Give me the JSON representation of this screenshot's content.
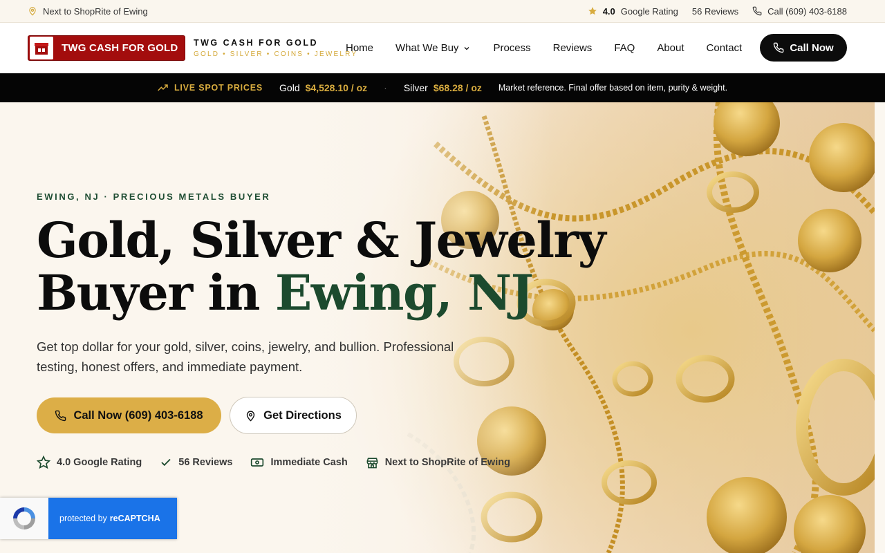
{
  "topbar": {
    "location": "Next to ShopRite of Ewing",
    "rating_value": "4.0",
    "rating_label": "Google Rating",
    "reviews": "56 Reviews",
    "phone": "Call (609) 403-6188"
  },
  "header": {
    "logo_badge": "TWG CASH FOR GOLD",
    "logo_title": "TWG CASH FOR GOLD",
    "logo_subtitle": "GOLD • SILVER • COINS • JEWELRY",
    "nav": [
      "Home",
      "What We Buy",
      "Process",
      "Reviews",
      "FAQ",
      "About",
      "Contact"
    ],
    "call_button": "Call Now"
  },
  "spotbar": {
    "label": "LIVE SPOT PRICES",
    "gold_label": "Gold",
    "gold_price": "$4,528.10 / oz",
    "separator": "·",
    "silver_label": "Silver",
    "silver_price": "$68.28 / oz",
    "note": "Market reference. Final offer based on item, purity & weight."
  },
  "hero": {
    "eyebrow": "EWING, NJ · PRECIOUS METALS BUYER",
    "headline_line1": "Gold, Silver & Jewelry",
    "headline_line2_prefix": "Buyer in ",
    "headline_line2_accent": "Ewing, NJ",
    "subtext": "Get top dollar for your gold, silver, coins, jewelry, and bullion. Professional testing, honest offers, and immediate payment.",
    "primary_button": "Call Now (609) 403-6188",
    "secondary_button": "Get Directions",
    "badges": [
      "4.0 Google Rating",
      "56 Reviews",
      "Immediate Cash",
      "Next to ShopRite of Ewing"
    ]
  },
  "recaptcha": {
    "text_prefix": "protected by",
    "text_brand": "reCAPTCHA"
  },
  "colors": {
    "brand_red": "#a30d0d",
    "gold_accent": "#dcae47",
    "green_accent": "#1c4a2e",
    "dark": "#050505"
  }
}
